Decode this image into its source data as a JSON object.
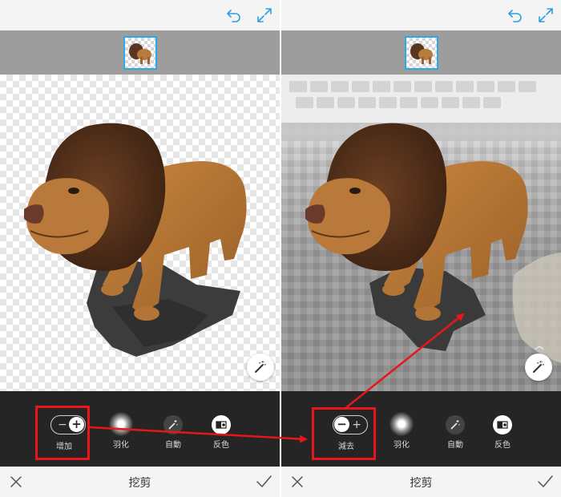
{
  "left": {
    "tools": [
      {
        "label": "增加",
        "icon": "plus-minus-toggle"
      },
      {
        "label": "羽化",
        "icon": "feather-icon"
      },
      {
        "label": "自動",
        "icon": "auto-wand-icon"
      },
      {
        "label": "反色",
        "icon": "invert-icon"
      }
    ],
    "title": "挖剪",
    "toggle_state": "add"
  },
  "right": {
    "tools": [
      {
        "label": "減去",
        "icon": "plus-minus-toggle"
      },
      {
        "label": "羽化",
        "icon": "feather-icon"
      },
      {
        "label": "自動",
        "icon": "auto-wand-icon"
      },
      {
        "label": "反色",
        "icon": "invert-icon"
      }
    ],
    "title": "挖剪",
    "toggle_state": "subtract"
  },
  "colors": {
    "accent_highlight": "#e8161b",
    "thumbnail_border": "#29a9e6",
    "toolbar_bg": "#252525"
  },
  "icons": {
    "undo": "undo-icon",
    "expand": "expand-icon",
    "magic_wand": "magic-wand-icon",
    "cancel": "close-icon",
    "confirm": "checkmark-icon"
  }
}
